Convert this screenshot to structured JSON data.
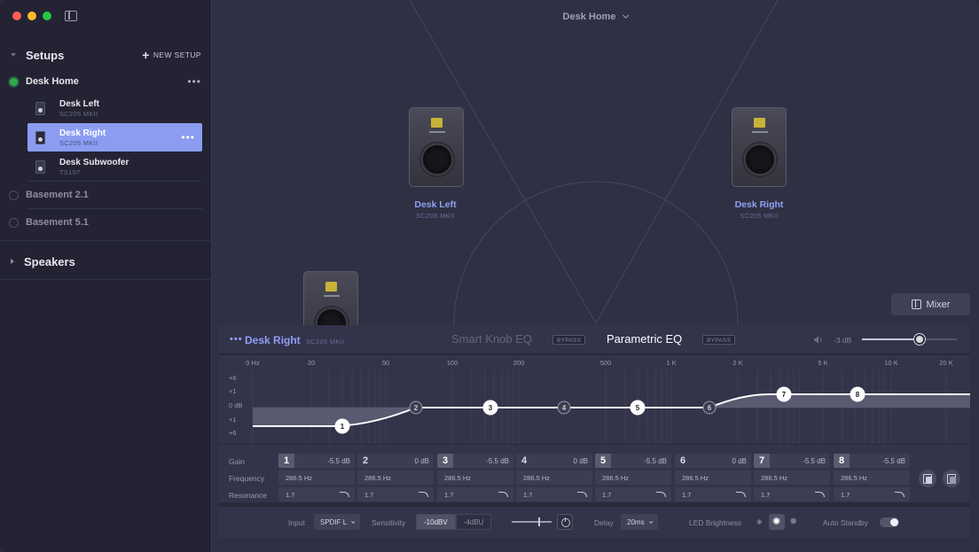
{
  "sidebar": {
    "title": "Setups",
    "new_setup": "NEW SETUP",
    "setups": [
      {
        "label": "Desk Home",
        "active": true
      },
      {
        "label": "Basement 2.1",
        "active": false
      },
      {
        "label": "Basement 5.1",
        "active": false
      }
    ],
    "speakers": [
      {
        "name": "Desk Left",
        "model": "SC205 MKII"
      },
      {
        "name": "Desk Right",
        "model": "SC205 MKII",
        "selected": true
      },
      {
        "name": "Desk Subwoofer",
        "model": "TS107"
      }
    ],
    "speakers_section": "Speakers",
    "menu_glyph": "•••"
  },
  "room": {
    "title": "Desk Home",
    "speakers": [
      {
        "name": "Desk Left",
        "model": "SC205 MKII"
      },
      {
        "name": "Desk Right",
        "model": "SC205 MKII"
      }
    ],
    "mixer_label": "Mixer"
  },
  "panel": {
    "menu_glyph": "•••",
    "speaker_name": "Desk Right",
    "speaker_model": "SC205 MKII",
    "tab_smart": "Smart Knob EQ",
    "tab_parametric": "Parametric EQ",
    "bypass": "BYPASS",
    "volume": "-3 dB",
    "volume_level": 0.61,
    "freq_labels": [
      "0 Hz",
      "20",
      "50",
      "100",
      "200",
      "500",
      "1 K",
      "2 K",
      "5 K",
      "10 K",
      "20 K"
    ],
    "gain_labels": [
      "+6",
      "+1",
      "0 dB",
      "+1",
      "+6"
    ],
    "row_labels": [
      "Gain",
      "Frequency",
      "Resonance"
    ],
    "bands": [
      {
        "num": "1",
        "gain": "-5.5 dB",
        "freq": "286.5 Hz",
        "res": "1.7",
        "active": true
      },
      {
        "num": "2",
        "gain": "0 dB",
        "freq": "286.5 Hz",
        "res": "1.7",
        "active": false
      },
      {
        "num": "3",
        "gain": "-5.5 dB",
        "freq": "286.5 Hz",
        "res": "1.7",
        "active": true
      },
      {
        "num": "4",
        "gain": "0 dB",
        "freq": "286.5 Hz",
        "res": "1.7",
        "active": false
      },
      {
        "num": "5",
        "gain": "-5.5 dB",
        "freq": "286.5 Hz",
        "res": "1.7",
        "active": true
      },
      {
        "num": "6",
        "gain": "0 dB",
        "freq": "286.5 Hz",
        "res": "1.7",
        "active": false
      },
      {
        "num": "7",
        "gain": "-5.5 dB",
        "freq": "286.5 Hz",
        "res": "1.7",
        "active": true
      },
      {
        "num": "8",
        "gain": "-5.5 dB",
        "freq": "286.5 Hz",
        "res": "1.7",
        "active": true
      }
    ]
  },
  "footer": {
    "input_label": "Input",
    "input_value": "SPDIF L",
    "sensitivity_label": "Sensitivity",
    "sens_opt1": "-10dBV",
    "sens_opt2": "-4dBU",
    "delay_label": "Delay",
    "delay_value": "20ms",
    "led_label": "LED Brightness",
    "standby_label": "Auto Standby"
  },
  "colors": {
    "accent": "#8b9cf1",
    "active_dot": "#2fa84f"
  }
}
